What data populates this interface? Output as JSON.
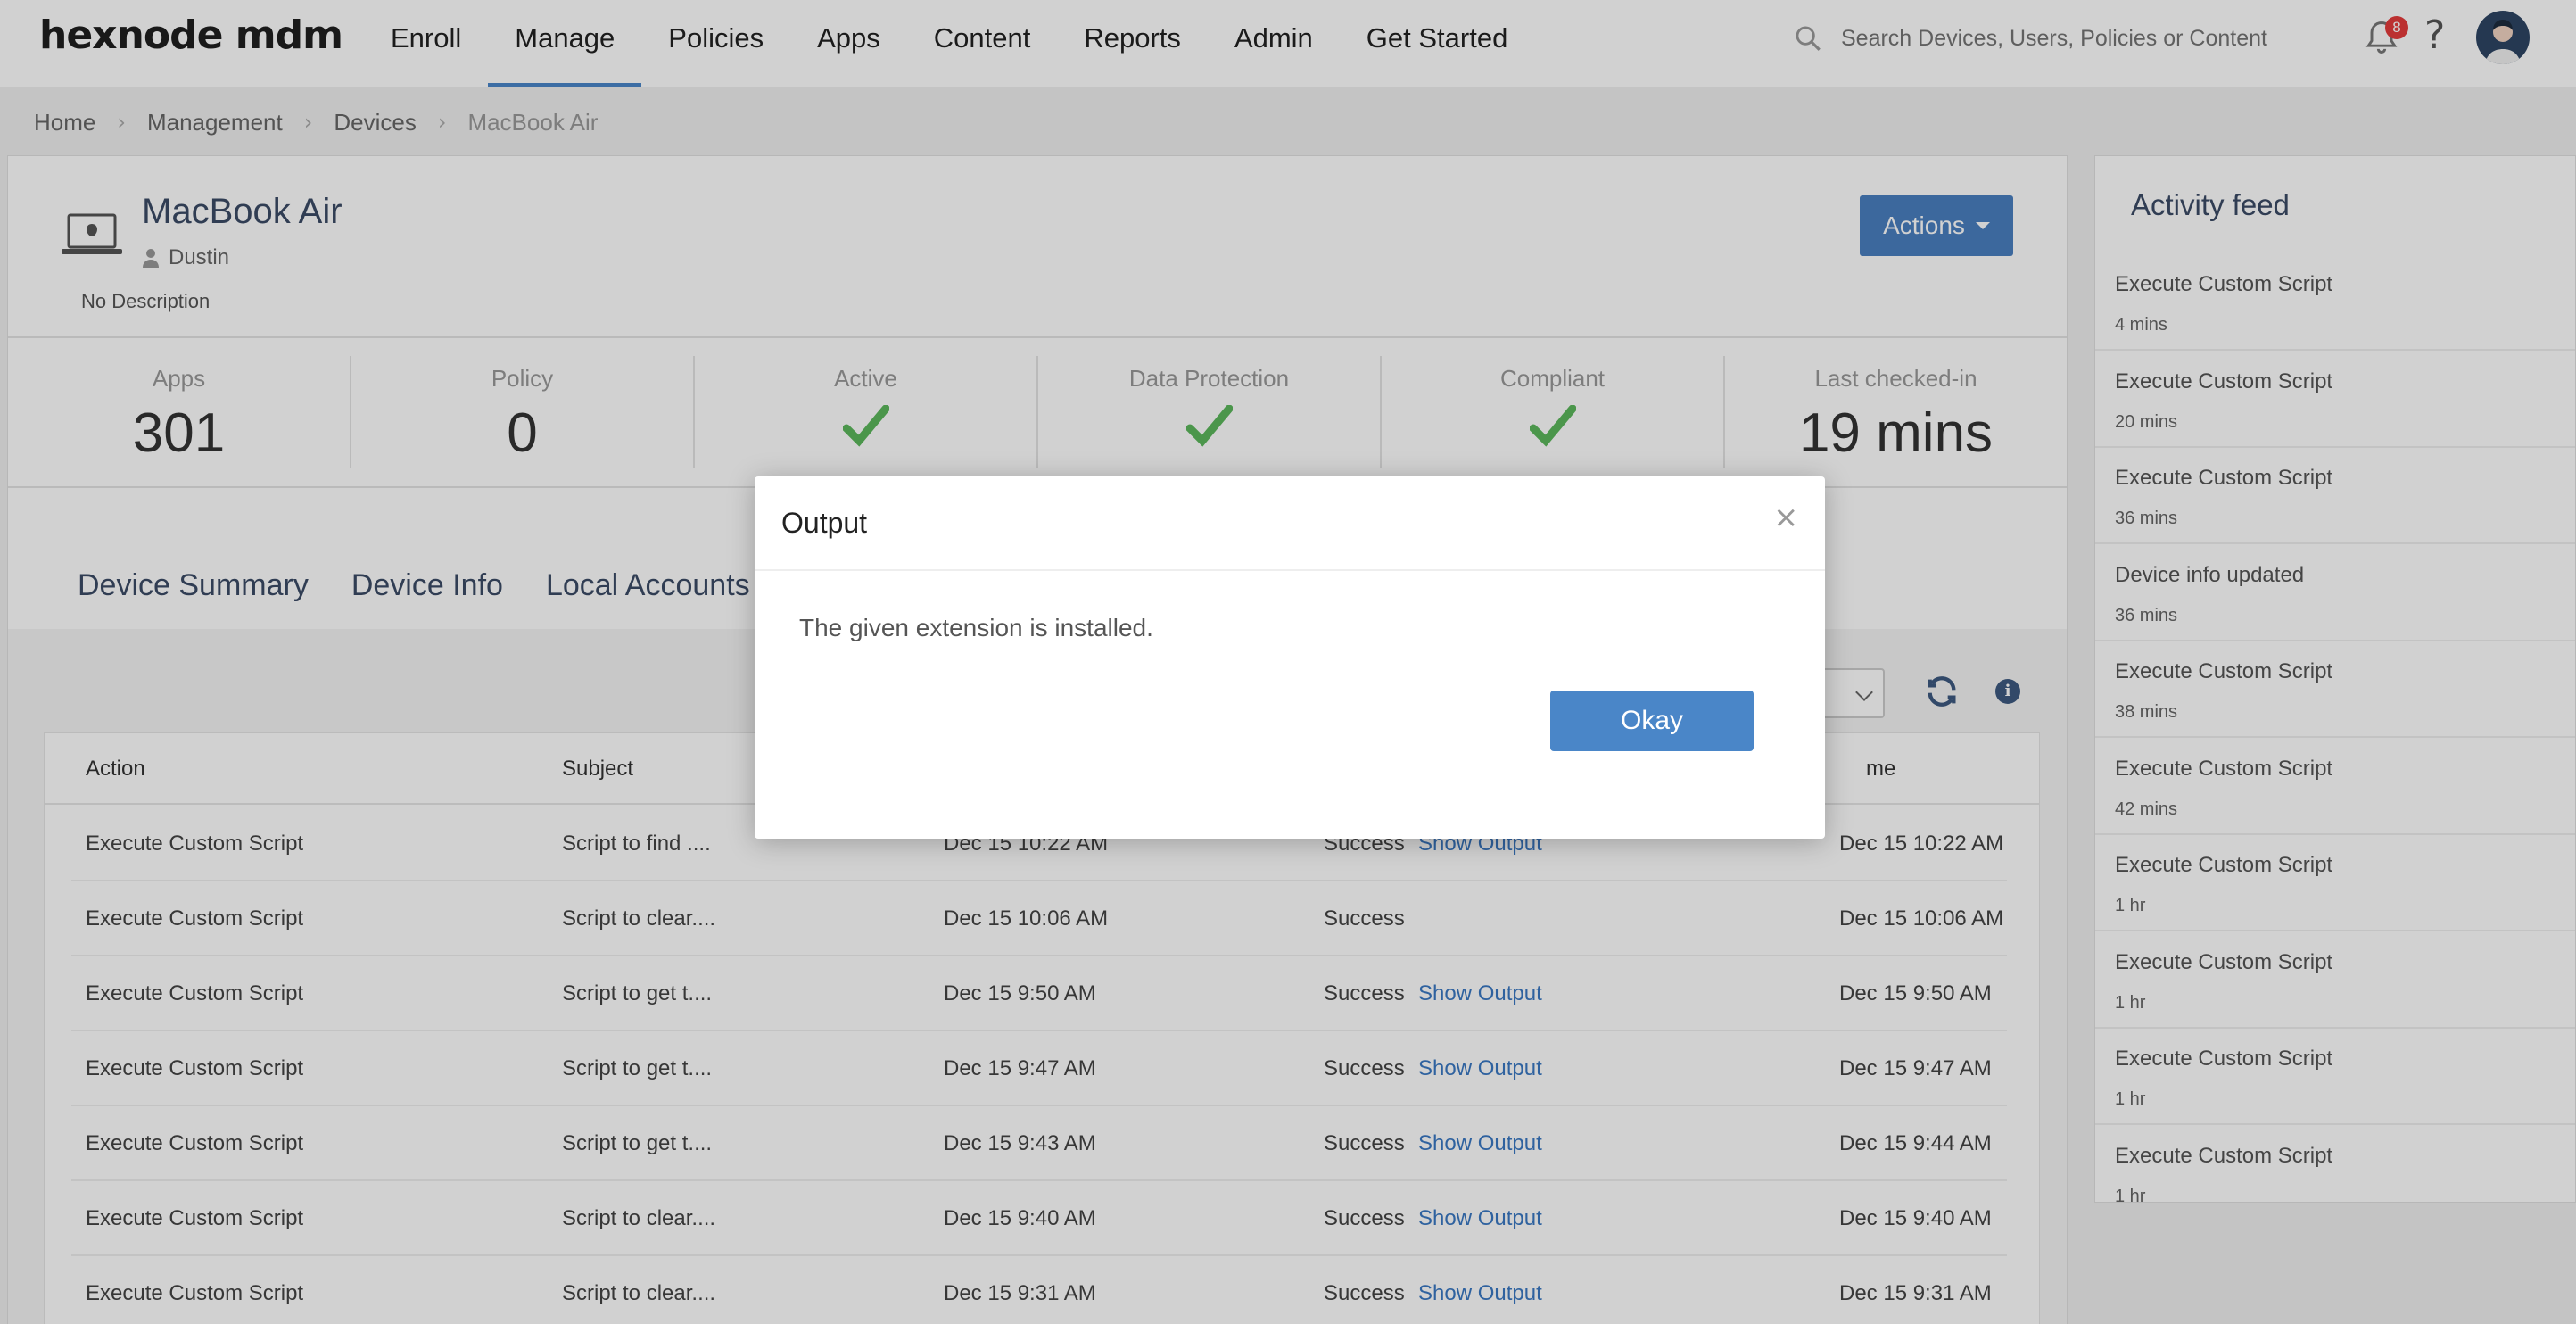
{
  "brand": {
    "logo": "hexnode mdm"
  },
  "nav": {
    "items": [
      "Enroll",
      "Manage",
      "Policies",
      "Apps",
      "Content",
      "Reports",
      "Admin",
      "Get Started"
    ],
    "active": "Manage",
    "search_placeholder": "Search Devices, Users, Policies or Content",
    "notification_count": "8"
  },
  "breadcrumb": [
    "Home",
    "Management",
    "Devices",
    "MacBook Air"
  ],
  "device": {
    "name": "MacBook Air",
    "user": "Dustin",
    "description": "No Description",
    "actions_label": "Actions"
  },
  "stats": {
    "apps": {
      "label": "Apps",
      "value": "301"
    },
    "policy": {
      "label": "Policy",
      "value": "0"
    },
    "active": {
      "label": "Active"
    },
    "data_protection": {
      "label": "Data Protection"
    },
    "compliant": {
      "label": "Compliant"
    },
    "last_checked_in": {
      "label": "Last checked-in",
      "value": "19 mins"
    }
  },
  "tabs": [
    "Device Summary",
    "Device Info",
    "Local Accounts"
  ],
  "table": {
    "headers": {
      "action": "Action",
      "subject": "Subject",
      "time_partial": "me"
    },
    "rows": [
      {
        "action": "Execute Custom Script",
        "subject": "Script to find ....",
        "time": "Dec 15 10:22 AM",
        "status": "Success",
        "output": "Show Output",
        "completed": "Dec 15 10:22 AM"
      },
      {
        "action": "Execute Custom Script",
        "subject": "Script to clear....",
        "time": "Dec 15 10:06 AM",
        "status": "Success",
        "output": "",
        "completed": "Dec 15 10:06 AM"
      },
      {
        "action": "Execute Custom Script",
        "subject": "Script to get t....",
        "time": "Dec 15 9:50 AM",
        "status": "Success",
        "output": "Show Output",
        "completed": "Dec 15 9:50 AM"
      },
      {
        "action": "Execute Custom Script",
        "subject": "Script to get t....",
        "time": "Dec 15 9:47 AM",
        "status": "Success",
        "output": "Show Output",
        "completed": "Dec 15 9:47 AM"
      },
      {
        "action": "Execute Custom Script",
        "subject": "Script to get t....",
        "time": "Dec 15 9:43 AM",
        "status": "Success",
        "output": "Show Output",
        "completed": "Dec 15 9:44 AM"
      },
      {
        "action": "Execute Custom Script",
        "subject": "Script to clear....",
        "time": "Dec 15 9:40 AM",
        "status": "Success",
        "output": "Show Output",
        "completed": "Dec 15 9:40 AM"
      },
      {
        "action": "Execute Custom Script",
        "subject": "Script to clear....",
        "time": "Dec 15 9:31 AM",
        "status": "Success",
        "output": "Show Output",
        "completed": "Dec 15 9:31 AM"
      }
    ]
  },
  "feed": {
    "title": "Activity feed",
    "items": [
      {
        "title": "Execute Custom Script",
        "time": "4 mins"
      },
      {
        "title": "Execute Custom Script",
        "time": "20 mins"
      },
      {
        "title": "Execute Custom Script",
        "time": "36 mins"
      },
      {
        "title": "Device info updated",
        "time": "36 mins"
      },
      {
        "title": "Execute Custom Script",
        "time": "38 mins"
      },
      {
        "title": "Execute Custom Script",
        "time": "42 mins"
      },
      {
        "title": "Execute Custom Script",
        "time": "1 hr"
      },
      {
        "title": "Execute Custom Script",
        "time": "1 hr"
      },
      {
        "title": "Execute Custom Script",
        "time": "1 hr"
      },
      {
        "title": "Execute Custom Script",
        "time": "1 hr"
      }
    ]
  },
  "modal": {
    "title": "Output",
    "close": "×",
    "body": "The given extension is installed.",
    "ok_label": "Okay"
  },
  "colors": {
    "accent": "#4a86c8",
    "check": "#5cb85c",
    "badge": "#e43b3b"
  }
}
